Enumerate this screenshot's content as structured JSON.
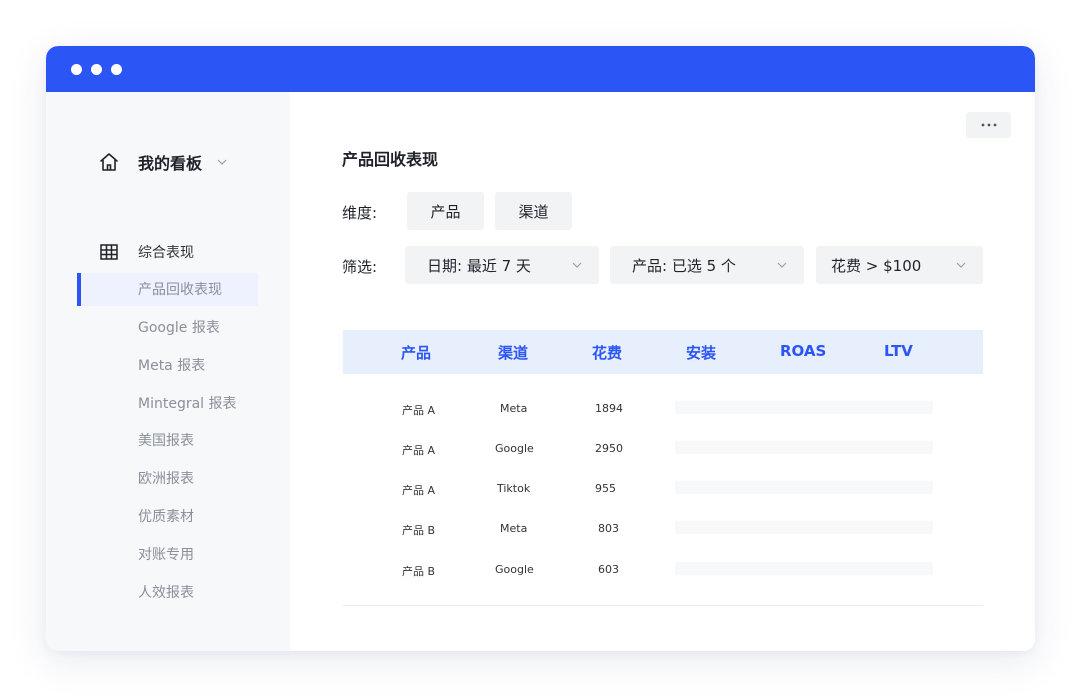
{
  "window": {
    "accent_color": "#2b55f5"
  },
  "sidebar": {
    "board_title": "我的看板",
    "group_label": "综合表现",
    "items": [
      {
        "label": "产品回收表现",
        "active": true
      },
      {
        "label": "Google 报表"
      },
      {
        "label": "Meta 报表"
      },
      {
        "label": "Mintegral 报表"
      },
      {
        "label": "美国报表"
      },
      {
        "label": "欧洲报表"
      },
      {
        "label": "优质素材"
      },
      {
        "label": "对账专用"
      },
      {
        "label": "人效报表"
      }
    ]
  },
  "main": {
    "title": "产品回收表现",
    "dimension": {
      "label": "维度:",
      "chips": [
        "产品",
        "渠道"
      ]
    },
    "filter": {
      "label": "筛选:",
      "selects": [
        "日期: 最近 7 天",
        "产品: 已选 5 个",
        "花费 > $100"
      ]
    },
    "table": {
      "headers": [
        "产品",
        "渠道",
        "花费",
        "安装",
        "ROAS",
        "LTV"
      ],
      "rows": [
        {
          "product": "产品 A",
          "channel": "Meta",
          "spend": "1894"
        },
        {
          "product": "产品 A",
          "channel": "Google",
          "spend": "2950"
        },
        {
          "product": "产品 A",
          "channel": "Tiktok",
          "spend": "955"
        },
        {
          "product": "产品 B",
          "channel": "Meta",
          "spend": "803"
        },
        {
          "product": "产品 B",
          "channel": "Google",
          "spend": "603"
        }
      ]
    }
  }
}
